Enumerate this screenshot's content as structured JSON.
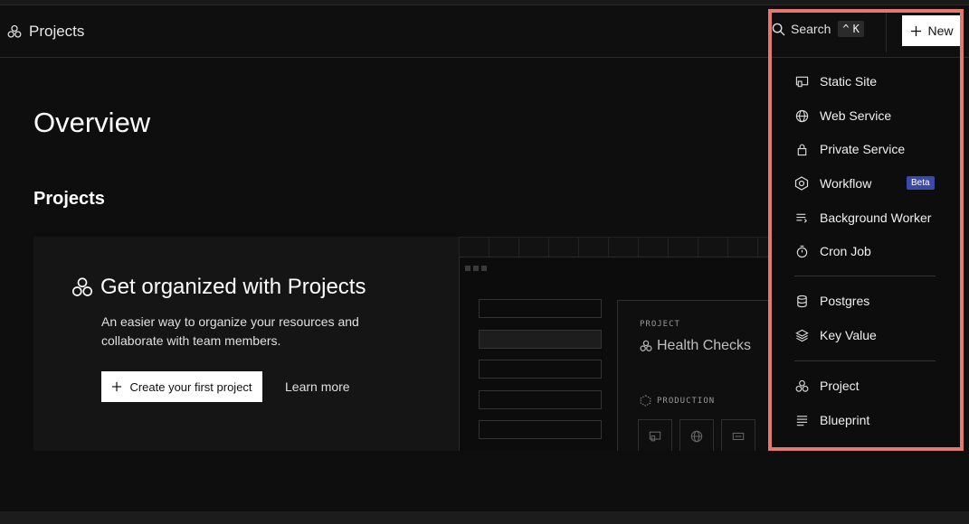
{
  "header": {
    "brand_label": "Projects",
    "search_label": "Search",
    "search_shortcut": "K",
    "new_label": "New"
  },
  "page": {
    "title": "Overview",
    "section_title": "Projects"
  },
  "promo": {
    "heading": "Get organized with Projects",
    "description": "An easier way to organize your resources and collaborate with team members.",
    "cta_label": "Create your first project",
    "learn_more": "Learn more",
    "mock_card": {
      "label": "PROJECT",
      "title": "Health Checks",
      "env": "PRODUCTION"
    }
  },
  "dropdown": {
    "items": [
      {
        "label": "Static Site",
        "icon": "static-site-icon"
      },
      {
        "label": "Web Service",
        "icon": "globe-icon"
      },
      {
        "label": "Private Service",
        "icon": "lock-icon"
      },
      {
        "label": "Workflow",
        "icon": "workflow-icon",
        "badge": "Beta"
      },
      {
        "label": "Background Worker",
        "icon": "worker-icon"
      },
      {
        "label": "Cron Job",
        "icon": "stopwatch-icon"
      },
      {
        "label": "Postgres",
        "icon": "database-icon"
      },
      {
        "label": "Key Value",
        "icon": "layers-icon"
      },
      {
        "label": "Project",
        "icon": "project-icon"
      },
      {
        "label": "Blueprint",
        "icon": "blueprint-icon"
      }
    ]
  },
  "colors": {
    "highlight": "#e07a70",
    "beta_badge": "#3a4aa8",
    "background": "#0e0e0e"
  }
}
